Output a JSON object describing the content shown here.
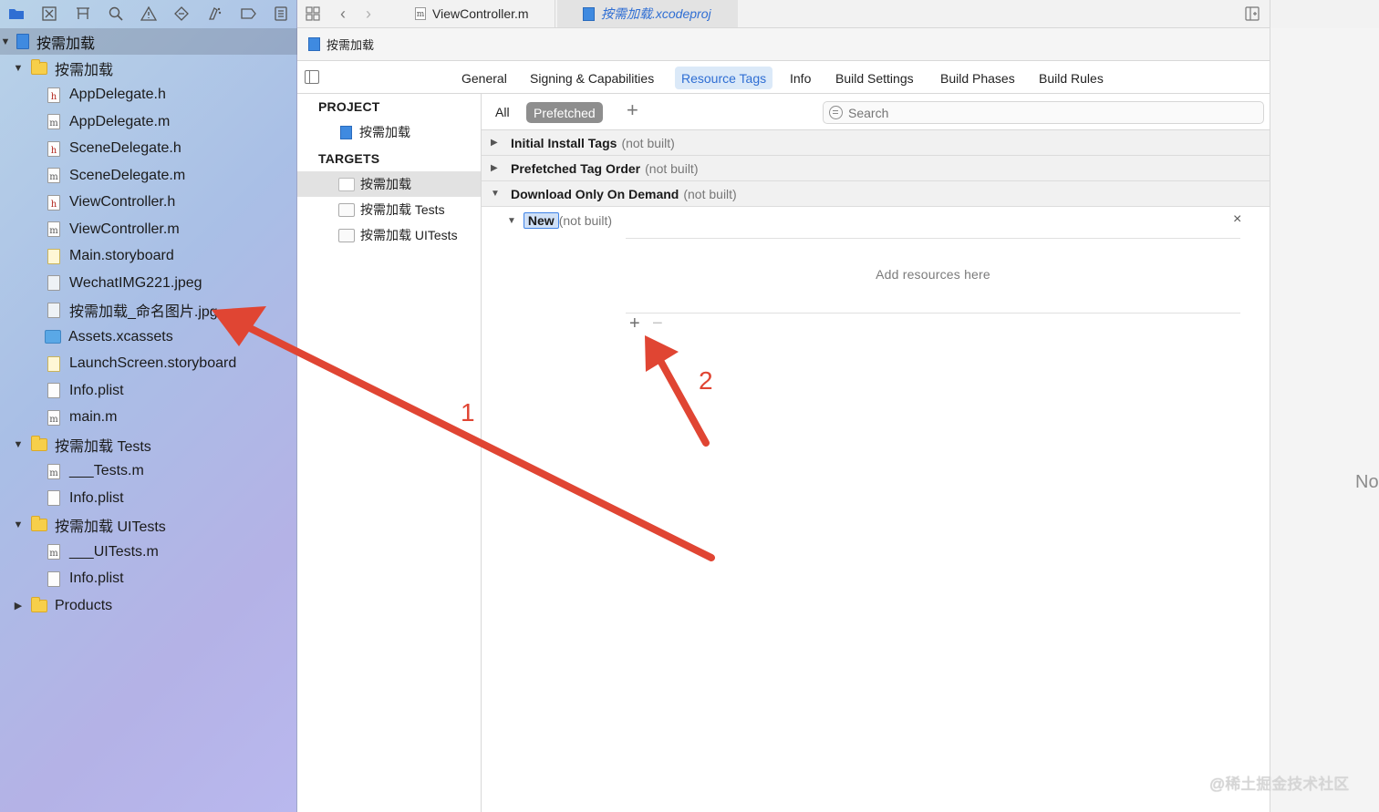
{
  "navigator": {
    "toolbar_icons": [
      "folder-icon",
      "source-control-icon",
      "symbol-icon",
      "find-icon",
      "issue-icon",
      "test-icon",
      "debug-icon",
      "breakpoint-icon",
      "report-icon"
    ],
    "project_root": "按需加载",
    "items": [
      {
        "label": "按需加载",
        "kind": "folder",
        "indent": 1,
        "expanded": true
      },
      {
        "label": "AppDelegate.h",
        "kind": "h",
        "indent": 2
      },
      {
        "label": "AppDelegate.m",
        "kind": "m",
        "indent": 2
      },
      {
        "label": "SceneDelegate.h",
        "kind": "h",
        "indent": 2
      },
      {
        "label": "SceneDelegate.m",
        "kind": "m",
        "indent": 2
      },
      {
        "label": "ViewController.h",
        "kind": "h",
        "indent": 2
      },
      {
        "label": "ViewController.m",
        "kind": "m",
        "indent": 2
      },
      {
        "label": "Main.storyboard",
        "kind": "storyboard",
        "indent": 2
      },
      {
        "label": "WechatIMG221.jpeg",
        "kind": "image",
        "indent": 2
      },
      {
        "label": "按需加载_命名图片.jpg",
        "kind": "image",
        "indent": 2
      },
      {
        "label": "Assets.xcassets",
        "kind": "assets",
        "indent": 2
      },
      {
        "label": "LaunchScreen.storyboard",
        "kind": "storyboard",
        "indent": 2
      },
      {
        "label": "Info.plist",
        "kind": "plist",
        "indent": 2
      },
      {
        "label": "main.m",
        "kind": "m",
        "indent": 2
      },
      {
        "label": "按需加载 Tests",
        "kind": "folder",
        "indent": 1,
        "expanded": true
      },
      {
        "label": "___Tests.m",
        "kind": "m",
        "indent": 2
      },
      {
        "label": "Info.plist",
        "kind": "plist",
        "indent": 2
      },
      {
        "label": "按需加载 UITests",
        "kind": "folder",
        "indent": 1,
        "expanded": true
      },
      {
        "label": "___UITests.m",
        "kind": "m",
        "indent": 2
      },
      {
        "label": "Info.plist",
        "kind": "plist",
        "indent": 2
      },
      {
        "label": "Products",
        "kind": "folder",
        "indent": 1,
        "expanded": false
      }
    ]
  },
  "editor": {
    "tabs": {
      "file_tab": "ViewController.m",
      "project_tab": "按需加载.xcodeproj"
    },
    "jumpbar": "按需加载"
  },
  "settings_tabs": [
    "General",
    "Signing & Capabilities",
    "Resource Tags",
    "Info",
    "Build Settings",
    "Build Phases",
    "Build Rules"
  ],
  "active_settings_tab": "Resource Tags",
  "targets_panel": {
    "project_header": "PROJECT",
    "project_item": "按需加载",
    "targets_header": "TARGETS",
    "targets": [
      "按需加载",
      "按需加载 Tests",
      "按需加载 UITests"
    ]
  },
  "resource_tags": {
    "filter_all": "All",
    "filter_prefetched": "Prefetched",
    "add_symbol": "+",
    "search_placeholder": "Search",
    "groups": [
      {
        "title": "Initial Install Tags",
        "status": "(not built)",
        "expanded": false
      },
      {
        "title": "Prefetched Tag Order",
        "status": "(not built)",
        "expanded": false
      },
      {
        "title": "Download Only On Demand",
        "status": "(not built)",
        "expanded": true
      }
    ],
    "tag": {
      "name": "New",
      "status": "(not built)"
    },
    "close_symbol": "×",
    "empty_message": "Add resources here",
    "add_resource_symbol": "+",
    "remove_resource_symbol": "−"
  },
  "inspector": {
    "label": "No"
  },
  "annotations": {
    "label_1": "1",
    "label_2": "2",
    "color": "#e04533"
  },
  "watermark": "@稀土掘金技术社区"
}
